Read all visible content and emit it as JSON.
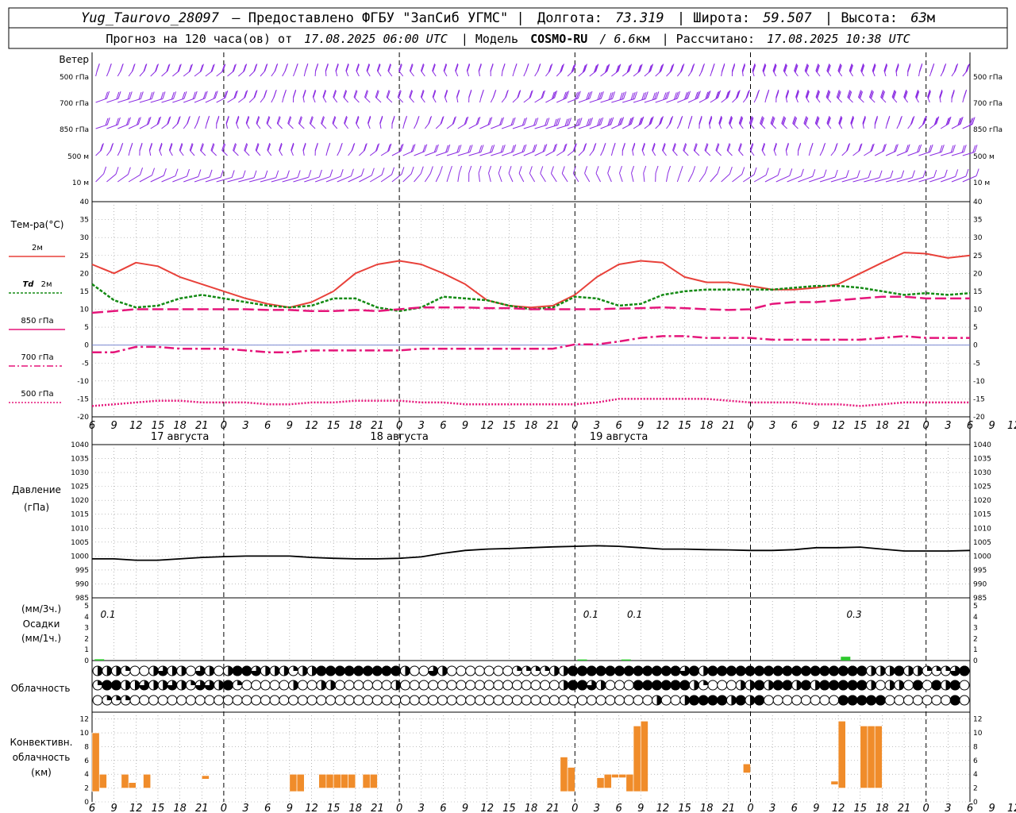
{
  "header": {
    "station": "Yug_Taurovo_28097",
    "provided": "– Предоставлено ФГБУ \"ЗапСиб УГМС\" |",
    "lon_label": "Долгота:",
    "lon_value": "73.319",
    "lat_label": "| Широта:",
    "lat_value": "59.507",
    "alt_label": "| Высота:",
    "alt_value": "63",
    "alt_unit": "м",
    "forecast_prefix": "Прогноз на 120 часа(ов) от",
    "forecast_time": "17.08.2025 06:00 UTC",
    "model_label": "| Модель",
    "model_name": "COSMO-RU",
    "model_res": "/ 6.6",
    "model_res_unit": "км",
    "calc_label": "| Рассчитано:",
    "calc_time": "17.08.2025 10:38 UTC"
  },
  "labels": {
    "wind": "Ветер",
    "wind_levels": [
      "500 гПа",
      "700 гПа",
      "850 гПа",
      "500 м",
      "10 м"
    ],
    "temp_title": "Тем-ра(°С)",
    "legend_2m": "2м",
    "legend_td": "Td",
    "legend_td_2m": "2м",
    "legend_850": "850 гПа",
    "legend_700": "700 гПа",
    "legend_500": "500 гПа",
    "pressure_title": "Давление",
    "pressure_unit": "(гПа)",
    "precip_unit3": "(мм/3ч.)",
    "precip_title": "Осадки",
    "precip_unit1": "(мм/1ч.)",
    "cloud_title": "Облачность",
    "conv_title1": "Конвективн.",
    "conv_title2": "облачность",
    "conv_title3": "(км)",
    "days": [
      "17 августа",
      "18 августа",
      "19 августа"
    ]
  },
  "colors": {
    "t2m": "#e8413a",
    "td2m": "#138a13",
    "t850": "#e5157a",
    "t700": "#e5157a",
    "t500": "#e5157a",
    "wind": "#8a2be2",
    "precip": "#2ec82e",
    "conv": "#f08c2a"
  },
  "chart_data": [
    {
      "type": "line",
      "name": "temperature",
      "x_hours": [
        0,
        3,
        6,
        9,
        12,
        15,
        18,
        21,
        24,
        27,
        30,
        33,
        36,
        39,
        42,
        45,
        48,
        51,
        54,
        57,
        60,
        63,
        66,
        69,
        72,
        75,
        78,
        81,
        84,
        87,
        90,
        93,
        96,
        99,
        102,
        105,
        108,
        111,
        114,
        117,
        120
      ],
      "x_tick_labels": [
        "6",
        "9",
        "12",
        "15",
        "18",
        "21",
        "0",
        "3",
        "6",
        "9",
        "12",
        "15",
        "18",
        "21",
        "0",
        "3",
        "6",
        "9",
        "12",
        "15",
        "18",
        "21",
        "0",
        "3",
        "6",
        "9",
        "12",
        "15",
        "18",
        "21",
        "0",
        "3",
        "6",
        "9",
        "12",
        "15",
        "18",
        "21",
        "0",
        "3",
        "6",
        "9",
        "12"
      ],
      "ylim": [
        -20,
        40
      ],
      "yticks": [
        -20,
        -15,
        -10,
        -5,
        0,
        5,
        10,
        15,
        20,
        25,
        30,
        35,
        40
      ],
      "series": [
        {
          "name": "2м",
          "values": [
            22.5,
            20,
            23,
            22,
            19,
            17,
            15,
            13,
            11.5,
            10.5,
            12,
            15,
            20,
            22.5,
            23.5,
            22.5,
            20,
            17,
            12.5,
            11,
            10.5,
            11,
            14,
            19,
            22.5,
            23.5,
            23,
            19,
            17.5,
            17.5,
            16.5,
            15.5,
            15.5,
            16,
            17,
            20,
            23,
            25.8,
            25.5,
            24.3,
            25
          ]
        },
        {
          "name": "Td 2м",
          "values": [
            17,
            12.5,
            10.5,
            11,
            13,
            14,
            13,
            12,
            11,
            10.5,
            11,
            13,
            13,
            10.5,
            9.5,
            10.5,
            13.5,
            13,
            12.5,
            11,
            10,
            10.5,
            13.5,
            13,
            11,
            11.5,
            14,
            15,
            15.5,
            15.5,
            15.5,
            15.5,
            16,
            16.5,
            16.5,
            16,
            15,
            14,
            14.5,
            14,
            14.5
          ]
        },
        {
          "name": "850 гПа",
          "values": [
            9,
            9.5,
            10,
            10,
            10,
            10,
            10,
            10,
            9.8,
            9.8,
            9.5,
            9.5,
            9.8,
            9.5,
            10,
            10.5,
            10.5,
            10.5,
            10.3,
            10.3,
            10,
            10,
            10,
            10,
            10.2,
            10.3,
            10.5,
            10.3,
            10,
            9.8,
            10,
            11.5,
            12,
            12,
            12.5,
            13,
            13.5,
            13.5,
            13,
            13,
            13
          ]
        },
        {
          "name": "700 гПа",
          "values": [
            -2,
            -2,
            -0.5,
            -0.5,
            -1,
            -1,
            -1,
            -1.5,
            -2,
            -2,
            -1.5,
            -1.5,
            -1.5,
            -1.5,
            -1.5,
            -1,
            -1,
            -1,
            -1,
            -1,
            -1,
            -1,
            0.2,
            0.2,
            1,
            2,
            2.5,
            2.5,
            2,
            2,
            2,
            1.5,
            1.5,
            1.5,
            1.5,
            1.5,
            2,
            2.5,
            2,
            2,
            2
          ]
        },
        {
          "name": "500 гПа",
          "values": [
            -17,
            -16.5,
            -16,
            -15.5,
            -15.5,
            -16,
            -16,
            -16,
            -16.5,
            -16.5,
            -16,
            -16,
            -15.5,
            -15.5,
            -15.5,
            -16,
            -16,
            -16.5,
            -16.5,
            -16.5,
            -16.5,
            -16.5,
            -16.5,
            -16,
            -15,
            -15,
            -15,
            -15,
            -15,
            -15.5,
            -16,
            -16,
            -16,
            -16.5,
            -16.5,
            -17,
            -16.5,
            -16,
            -16,
            -16,
            -16
          ]
        }
      ]
    },
    {
      "type": "line",
      "name": "pressure",
      "ylim": [
        985,
        1040
      ],
      "yticks": [
        985,
        990,
        995,
        1000,
        1005,
        1010,
        1015,
        1020,
        1025,
        1030,
        1035,
        1040
      ],
      "series": [
        {
          "name": "pressure",
          "values": [
            999,
            999,
            998.5,
            998.5,
            999,
            999.5,
            999.8,
            1000,
            1000,
            1000,
            999.5,
            999.2,
            999,
            999,
            999.2,
            999.7,
            1001,
            1002,
            1002.5,
            1002.7,
            1003,
            1003.3,
            1003.5,
            1003.7,
            1003.5,
            1003,
            1002.5,
            1002.5,
            1002.3,
            1002.2,
            1002,
            1002,
            1002.3,
            1003,
            1003,
            1003.2,
            1002.5,
            1001.8,
            1001.8,
            1001.8,
            1002
          ]
        }
      ]
    },
    {
      "type": "bar",
      "name": "precipitation",
      "ylim": [
        0,
        5
      ],
      "yticks": [
        0,
        1,
        2,
        3,
        4,
        5
      ],
      "labels": [
        {
          "x_hour": 0,
          "text": "0.1"
        },
        {
          "x_hour": 66,
          "text": "0.1"
        },
        {
          "x_hour": 72,
          "text": "0.1"
        },
        {
          "x_hour": 102,
          "text": "0.3"
        }
      ],
      "bars": [
        {
          "x_hour": 1,
          "value": 0.12
        },
        {
          "x_hour": 67,
          "value": 0.1
        },
        {
          "x_hour": 73,
          "value": 0.1
        },
        {
          "x_hour": 103,
          "value": 0.35
        }
      ]
    },
    {
      "type": "bar",
      "name": "convective_cloud",
      "ylim": [
        0,
        13
      ],
      "yticks": [
        0,
        2,
        4,
        6,
        8,
        10,
        12
      ],
      "bars": [
        {
          "x_hour": 0.5,
          "base": 1.5,
          "top": 10
        },
        {
          "x_hour": 1.5,
          "base": 2,
          "top": 4
        },
        {
          "x_hour": 4.5,
          "base": 2,
          "top": 4
        },
        {
          "x_hour": 5.5,
          "base": 2,
          "top": 2.8
        },
        {
          "x_hour": 7.5,
          "base": 2,
          "top": 4
        },
        {
          "x_hour": 15.5,
          "base": 3.3,
          "top": 3.8
        },
        {
          "x_hour": 27.5,
          "base": 1.5,
          "top": 4
        },
        {
          "x_hour": 28.5,
          "base": 1.5,
          "top": 4
        },
        {
          "x_hour": 31.5,
          "base": 2,
          "top": 4
        },
        {
          "x_hour": 32.5,
          "base": 2,
          "top": 4
        },
        {
          "x_hour": 33.5,
          "base": 2,
          "top": 4
        },
        {
          "x_hour": 34.5,
          "base": 2,
          "top": 4
        },
        {
          "x_hour": 35.5,
          "base": 2,
          "top": 4
        },
        {
          "x_hour": 37.5,
          "base": 2,
          "top": 4
        },
        {
          "x_hour": 38.5,
          "base": 2,
          "top": 4
        },
        {
          "x_hour": 64.5,
          "base": 1.5,
          "top": 6.5
        },
        {
          "x_hour": 65.5,
          "base": 1.5,
          "top": 5
        },
        {
          "x_hour": 69.5,
          "base": 2,
          "top": 3.5
        },
        {
          "x_hour": 70.5,
          "base": 2,
          "top": 4
        },
        {
          "x_hour": 71.5,
          "base": 3.5,
          "top": 4
        },
        {
          "x_hour": 72.5,
          "base": 3.5,
          "top": 4
        },
        {
          "x_hour": 73.5,
          "base": 1.5,
          "top": 4
        },
        {
          "x_hour": 74.5,
          "base": 1.5,
          "top": 11
        },
        {
          "x_hour": 75.5,
          "base": 1.5,
          "top": 11.7
        },
        {
          "x_hour": 89.5,
          "base": 4.2,
          "top": 5.5
        },
        {
          "x_hour": 101.5,
          "base": 2.5,
          "top": 3
        },
        {
          "x_hour": 102.5,
          "base": 2,
          "top": 11.7
        },
        {
          "x_hour": 105.5,
          "base": 2,
          "top": 11
        },
        {
          "x_hour": 106.5,
          "base": 2,
          "top": 11
        },
        {
          "x_hour": 107.5,
          "base": 2,
          "top": 11
        }
      ]
    },
    {
      "type": "table",
      "name": "cloudiness_octas",
      "rows": [
        [
          4,
          4,
          4,
          2,
          0,
          0,
          4,
          6,
          4,
          4,
          0,
          6,
          4,
          0,
          4,
          8,
          8,
          6,
          4,
          4,
          4,
          2,
          4,
          4,
          8,
          8,
          8,
          8,
          8,
          8,
          8,
          8,
          8,
          4,
          0,
          0,
          6,
          4,
          0,
          0,
          0,
          0,
          0,
          0,
          0,
          2,
          2,
          2,
          2,
          4,
          4,
          8,
          8,
          8,
          8,
          8,
          8,
          8,
          8,
          8,
          8,
          8,
          8,
          6,
          8,
          4,
          8,
          8,
          8,
          8,
          8,
          8,
          8,
          8,
          8,
          8,
          8,
          8,
          8,
          8,
          8,
          8,
          8,
          4,
          4,
          4,
          8,
          4,
          4,
          2,
          2,
          2,
          6,
          8
        ],
        [
          2,
          8,
          8,
          4,
          4,
          6,
          4,
          4,
          6,
          4,
          2,
          6,
          6,
          4,
          8,
          2,
          0,
          0,
          0,
          0,
          0,
          4,
          0,
          0,
          4,
          4,
          0,
          0,
          0,
          0,
          0,
          0,
          4,
          0,
          0,
          0,
          0,
          0,
          0,
          0,
          0,
          0,
          0,
          0,
          0,
          0,
          0,
          0,
          0,
          0,
          4,
          8,
          8,
          6,
          4,
          0,
          0,
          0,
          8,
          8,
          8,
          8,
          8,
          8,
          4,
          2,
          0,
          0,
          0,
          4,
          4,
          8,
          4,
          8,
          8,
          4,
          8,
          4,
          8,
          8,
          8,
          8,
          8,
          4,
          0,
          4,
          4,
          0,
          8,
          0,
          8,
          4,
          8,
          0
        ],
        [
          0,
          2,
          2,
          2,
          0,
          0,
          0,
          0,
          0,
          0,
          0,
          0,
          0,
          0,
          0,
          0,
          0,
          0,
          0,
          0,
          0,
          0,
          0,
          0,
          0,
          0,
          0,
          0,
          0,
          0,
          0,
          0,
          0,
          0,
          0,
          0,
          0,
          0,
          0,
          0,
          0,
          0,
          0,
          0,
          0,
          0,
          0,
          0,
          0,
          0,
          0,
          0,
          0,
          0,
          0,
          0,
          0,
          0,
          0,
          0,
          4,
          0,
          0,
          4,
          8,
          8,
          8,
          8,
          4,
          8,
          4,
          8,
          0,
          0,
          0,
          0,
          0,
          0,
          0,
          0,
          8,
          8,
          8,
          8,
          8,
          0,
          0,
          0,
          0,
          0,
          0,
          0,
          8,
          0
        ]
      ]
    }
  ]
}
